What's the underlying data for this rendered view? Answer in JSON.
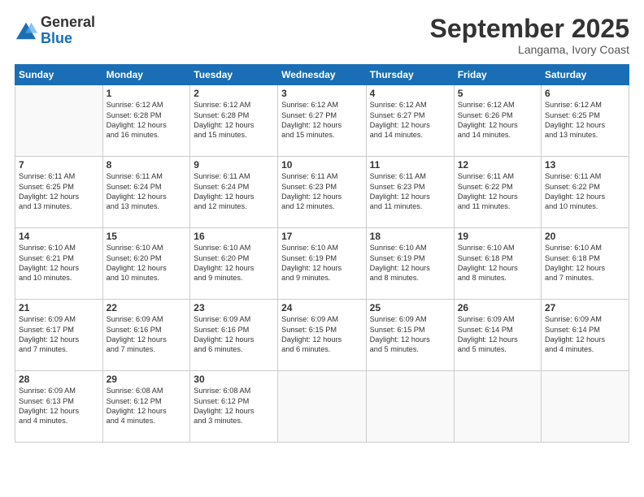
{
  "header": {
    "logo_general": "General",
    "logo_blue": "Blue",
    "month_title": "September 2025",
    "location": "Langama, Ivory Coast"
  },
  "weekdays": [
    "Sunday",
    "Monday",
    "Tuesday",
    "Wednesday",
    "Thursday",
    "Friday",
    "Saturday"
  ],
  "weeks": [
    [
      {
        "day": "",
        "info": ""
      },
      {
        "day": "1",
        "info": "Sunrise: 6:12 AM\nSunset: 6:28 PM\nDaylight: 12 hours\nand 16 minutes."
      },
      {
        "day": "2",
        "info": "Sunrise: 6:12 AM\nSunset: 6:28 PM\nDaylight: 12 hours\nand 15 minutes."
      },
      {
        "day": "3",
        "info": "Sunrise: 6:12 AM\nSunset: 6:27 PM\nDaylight: 12 hours\nand 15 minutes."
      },
      {
        "day": "4",
        "info": "Sunrise: 6:12 AM\nSunset: 6:27 PM\nDaylight: 12 hours\nand 14 minutes."
      },
      {
        "day": "5",
        "info": "Sunrise: 6:12 AM\nSunset: 6:26 PM\nDaylight: 12 hours\nand 14 minutes."
      },
      {
        "day": "6",
        "info": "Sunrise: 6:12 AM\nSunset: 6:25 PM\nDaylight: 12 hours\nand 13 minutes."
      }
    ],
    [
      {
        "day": "7",
        "info": "Sunrise: 6:11 AM\nSunset: 6:25 PM\nDaylight: 12 hours\nand 13 minutes."
      },
      {
        "day": "8",
        "info": "Sunrise: 6:11 AM\nSunset: 6:24 PM\nDaylight: 12 hours\nand 13 minutes."
      },
      {
        "day": "9",
        "info": "Sunrise: 6:11 AM\nSunset: 6:24 PM\nDaylight: 12 hours\nand 12 minutes."
      },
      {
        "day": "10",
        "info": "Sunrise: 6:11 AM\nSunset: 6:23 PM\nDaylight: 12 hours\nand 12 minutes."
      },
      {
        "day": "11",
        "info": "Sunrise: 6:11 AM\nSunset: 6:23 PM\nDaylight: 12 hours\nand 11 minutes."
      },
      {
        "day": "12",
        "info": "Sunrise: 6:11 AM\nSunset: 6:22 PM\nDaylight: 12 hours\nand 11 minutes."
      },
      {
        "day": "13",
        "info": "Sunrise: 6:11 AM\nSunset: 6:22 PM\nDaylight: 12 hours\nand 10 minutes."
      }
    ],
    [
      {
        "day": "14",
        "info": "Sunrise: 6:10 AM\nSunset: 6:21 PM\nDaylight: 12 hours\nand 10 minutes."
      },
      {
        "day": "15",
        "info": "Sunrise: 6:10 AM\nSunset: 6:20 PM\nDaylight: 12 hours\nand 10 minutes."
      },
      {
        "day": "16",
        "info": "Sunrise: 6:10 AM\nSunset: 6:20 PM\nDaylight: 12 hours\nand 9 minutes."
      },
      {
        "day": "17",
        "info": "Sunrise: 6:10 AM\nSunset: 6:19 PM\nDaylight: 12 hours\nand 9 minutes."
      },
      {
        "day": "18",
        "info": "Sunrise: 6:10 AM\nSunset: 6:19 PM\nDaylight: 12 hours\nand 8 minutes."
      },
      {
        "day": "19",
        "info": "Sunrise: 6:10 AM\nSunset: 6:18 PM\nDaylight: 12 hours\nand 8 minutes."
      },
      {
        "day": "20",
        "info": "Sunrise: 6:10 AM\nSunset: 6:18 PM\nDaylight: 12 hours\nand 7 minutes."
      }
    ],
    [
      {
        "day": "21",
        "info": "Sunrise: 6:09 AM\nSunset: 6:17 PM\nDaylight: 12 hours\nand 7 minutes."
      },
      {
        "day": "22",
        "info": "Sunrise: 6:09 AM\nSunset: 6:16 PM\nDaylight: 12 hours\nand 7 minutes."
      },
      {
        "day": "23",
        "info": "Sunrise: 6:09 AM\nSunset: 6:16 PM\nDaylight: 12 hours\nand 6 minutes."
      },
      {
        "day": "24",
        "info": "Sunrise: 6:09 AM\nSunset: 6:15 PM\nDaylight: 12 hours\nand 6 minutes."
      },
      {
        "day": "25",
        "info": "Sunrise: 6:09 AM\nSunset: 6:15 PM\nDaylight: 12 hours\nand 5 minutes."
      },
      {
        "day": "26",
        "info": "Sunrise: 6:09 AM\nSunset: 6:14 PM\nDaylight: 12 hours\nand 5 minutes."
      },
      {
        "day": "27",
        "info": "Sunrise: 6:09 AM\nSunset: 6:14 PM\nDaylight: 12 hours\nand 4 minutes."
      }
    ],
    [
      {
        "day": "28",
        "info": "Sunrise: 6:09 AM\nSunset: 6:13 PM\nDaylight: 12 hours\nand 4 minutes."
      },
      {
        "day": "29",
        "info": "Sunrise: 6:08 AM\nSunset: 6:12 PM\nDaylight: 12 hours\nand 4 minutes."
      },
      {
        "day": "30",
        "info": "Sunrise: 6:08 AM\nSunset: 6:12 PM\nDaylight: 12 hours\nand 3 minutes."
      },
      {
        "day": "",
        "info": ""
      },
      {
        "day": "",
        "info": ""
      },
      {
        "day": "",
        "info": ""
      },
      {
        "day": "",
        "info": ""
      }
    ]
  ]
}
